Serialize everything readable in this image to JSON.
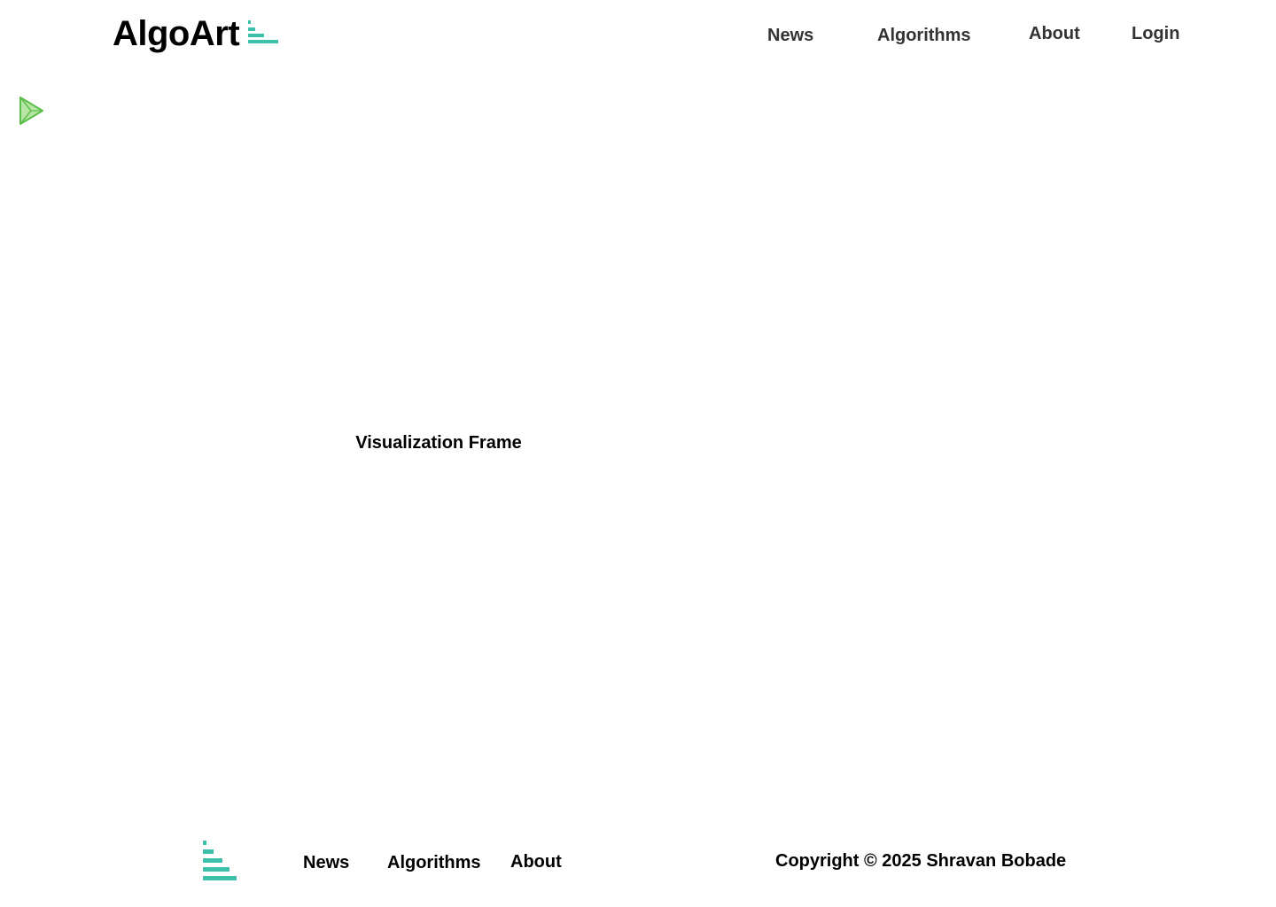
{
  "header": {
    "logo_text": "AlgoArt",
    "logo_icon": "bar-chart-icon",
    "nav": {
      "news": "News",
      "algorithms": "Algorithms",
      "about": "About",
      "login": "Login"
    }
  },
  "controls": {
    "play_icon": "play-icon"
  },
  "main": {
    "frame_label": "Visualization Frame"
  },
  "footer": {
    "logo_icon": "bar-chart-icon",
    "nav": {
      "news": "News",
      "algorithms": "Algorithms",
      "about": "About"
    },
    "copyright": "Copyright © 2025 Shravan Bobade"
  },
  "colors": {
    "brand_teal": "#3dbfa9",
    "play_green": "#5cbf4a",
    "play_fill": "#b9e6a6",
    "nav_text": "#333333"
  }
}
